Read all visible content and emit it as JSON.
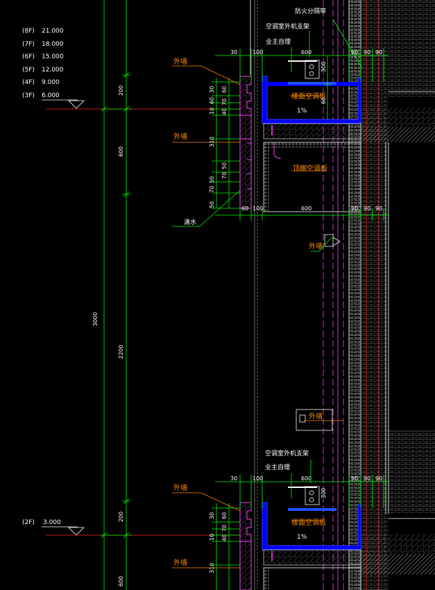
{
  "levels": [
    {
      "floor": "(8F)",
      "elevation": "21.000"
    },
    {
      "floor": "(7F)",
      "elevation": "18.000"
    },
    {
      "floor": "(6F)",
      "elevation": "15.000"
    },
    {
      "floor": "(5F)",
      "elevation": "12.000"
    },
    {
      "floor": "(4F)",
      "elevation": "9.000"
    },
    {
      "floor": "(3F)",
      "elevation": "6.000"
    }
  ],
  "level_2f": {
    "floor": "(2F)",
    "elevation": "3.000"
  },
  "vertical_dims": {
    "total": "3000",
    "d200a": "200",
    "d600": "600",
    "d2200": "2200",
    "d200b": "200",
    "d600b": "600"
  },
  "labels": {
    "fire_zone": "防火分隔带",
    "ac_bracket_top": "空调室外机支架",
    "owner_top": "业主自理",
    "ac_bracket_bottom": "空调室外机支架",
    "owner_bottom": "业主自理",
    "outer_wall": "外墙",
    "drip": "滴水",
    "floor_ac_board": "楼面空调板",
    "ceiling_ac_board": "顶棚空调板",
    "slope": "1%"
  },
  "horiz_dims_top": [
    "30",
    "100",
    "600",
    "90",
    "90",
    "90"
  ],
  "horiz_dims_mid": [
    "60",
    "100",
    "600",
    "90",
    "90",
    "90"
  ],
  "horiz_dims_bottom": [
    "30",
    "100",
    "600",
    "90",
    "90",
    "90"
  ],
  "left_small_dims": [
    "30",
    "60",
    "70",
    "10",
    "40",
    "310",
    "50",
    "70",
    "50",
    "70",
    "50"
  ],
  "small_dims_marks": [
    "300",
    "60",
    "300"
  ]
}
